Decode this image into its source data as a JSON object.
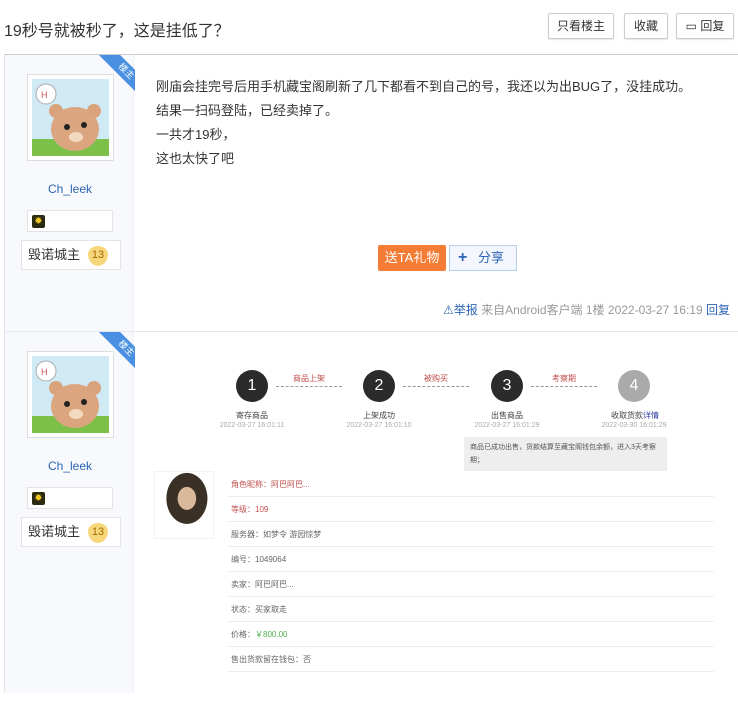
{
  "header": {
    "title": "19秒号就被秒了，这是挂低了？",
    "only_op": "只看楼主",
    "favorite": "收藏",
    "reply": "回复"
  },
  "posts": [
    {
      "corner": "楼主",
      "username": "Ch_leek",
      "rank": "毁诺城主",
      "level": "13",
      "lines": [
        "刚庙会挂完号后用手机藏宝阁刷新了几下都看不到自己的号，我还以为出BUG了，没挂成功。",
        "结果一扫码登陆，已经卖掉了。",
        "一共才19秒，",
        "这也太快了吧"
      ],
      "gift": "送TA礼物",
      "share": "分享",
      "report": "举报",
      "source": "来自Android客户端",
      "floor": "1楼",
      "time": "2022-03-27 16:19",
      "reply": "回复"
    },
    {
      "corner": "楼主",
      "username": "Ch_leek",
      "rank": "毁诺城主",
      "level": "13"
    }
  ],
  "screenshot": {
    "steps": [
      {
        "n": "1",
        "label": "寄存商品",
        "date": "2022-03-27 16:01:11"
      },
      {
        "n": "2",
        "label": "上架成功",
        "date": "2022-03-27 16:01:10"
      },
      {
        "n": "3",
        "label": "出售商品",
        "date": "2022-03-27 16:01:29"
      },
      {
        "n": "4",
        "label": "收取货款",
        "date": "2022-03-30 16:01:29"
      }
    ],
    "detail_link": "详情",
    "connectors": [
      "商品上架",
      "被购买",
      "考察期"
    ],
    "tip": "商品已成功出售，货款结算至藏宝阁钱包余额，进入3天考察期；",
    "rows": [
      {
        "label": "角色昵称：",
        "value": "阿巴阿巴..."
      },
      {
        "label": "等级：",
        "value": "109"
      },
      {
        "label": "服务器：",
        "value": "如梦令 游园惊梦"
      },
      {
        "label": "编号：",
        "value": "1049064"
      },
      {
        "label": "卖家：",
        "value": "阿巴阿巴..."
      },
      {
        "label": "状态：",
        "value": "买家取走"
      },
      {
        "label": "价格：",
        "value": "￥800.00"
      },
      {
        "label": "售出货款留在钱包：",
        "value": "否"
      }
    ]
  }
}
